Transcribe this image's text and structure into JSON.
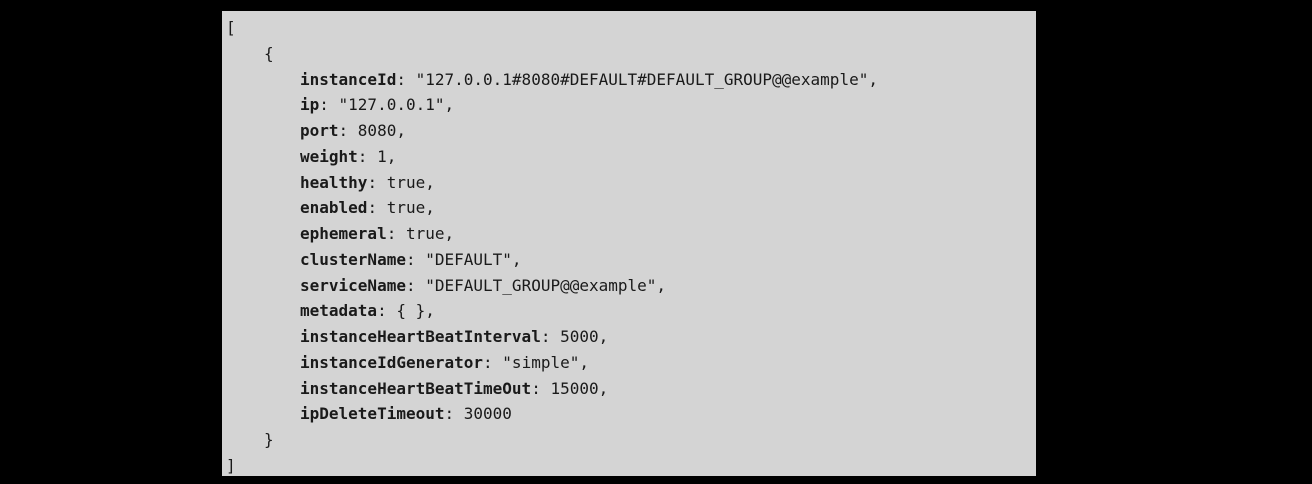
{
  "json_view": {
    "open_array": "[",
    "open_object": "{",
    "close_object": "}",
    "close_array": "]",
    "fields": [
      {
        "key": "instanceId",
        "value": "\"127.0.0.1#8080#DEFAULT#DEFAULT_GROUP@@example\","
      },
      {
        "key": "ip",
        "value": "\"127.0.0.1\","
      },
      {
        "key": "port",
        "value": "8080,"
      },
      {
        "key": "weight",
        "value": "1,"
      },
      {
        "key": "healthy",
        "value": "true,"
      },
      {
        "key": "enabled",
        "value": "true,"
      },
      {
        "key": "ephemeral",
        "value": "true,"
      },
      {
        "key": "clusterName",
        "value": "\"DEFAULT\","
      },
      {
        "key": "serviceName",
        "value": "\"DEFAULT_GROUP@@example\","
      },
      {
        "key": "metadata",
        "value": "{ },"
      },
      {
        "key": "instanceHeartBeatInterval",
        "value": "5000,"
      },
      {
        "key": "instanceIdGenerator",
        "value": "\"simple\","
      },
      {
        "key": "instanceHeartBeatTimeOut",
        "value": "15000,"
      },
      {
        "key": "ipDeleteTimeout",
        "value": "30000"
      }
    ]
  }
}
